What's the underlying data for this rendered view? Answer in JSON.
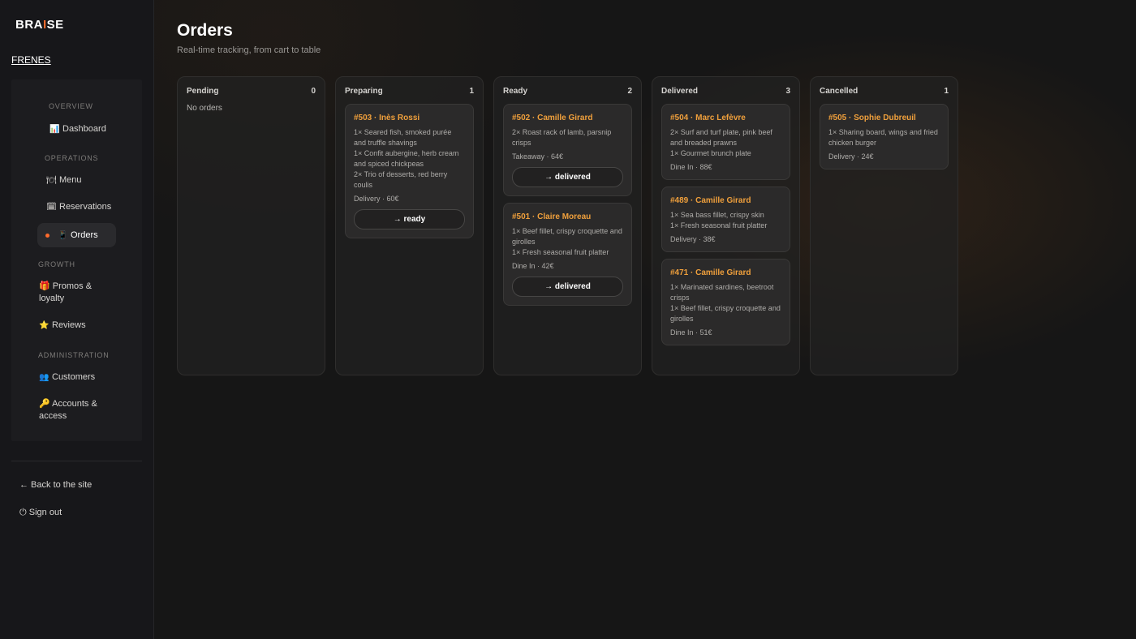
{
  "brand": {
    "prefix": "BRA",
    "accent": "I",
    "suffix": "SE",
    "accent_color": "#ff6b2c"
  },
  "tenant": "FRENES",
  "nav": {
    "sections": {
      "overview": "OVERVIEW",
      "operations": "OPERATIONS",
      "growth": "GROWTH",
      "administration": "ADMINISTRATION"
    },
    "items": {
      "dashboard": {
        "icon": "📊",
        "label": "Dashboard"
      },
      "menu": {
        "icon": "🍽",
        "label": "Menu"
      },
      "reservations": {
        "icon": "🗓",
        "label": "Reservations"
      },
      "orders": {
        "icon": "📱",
        "label": "Orders"
      },
      "promos": {
        "icon": "🎁",
        "label": "Promos & loyalty"
      },
      "reviews": {
        "icon": "⭐",
        "label": "Reviews"
      },
      "customers": {
        "icon": "👥",
        "label": "Customers"
      },
      "accounts": {
        "icon": "🔑",
        "label": "Accounts & access"
      }
    }
  },
  "footer": {
    "back": "← Back to the site",
    "signout": "⏻ Sign out"
  },
  "page": {
    "title": "Orders",
    "subtitle": "Real-time tracking, from cart to table"
  },
  "columns": {
    "pending": {
      "name": "Pending",
      "count": "0",
      "empty": "No orders"
    },
    "preparing": {
      "name": "Preparing",
      "count": "1",
      "cards": [
        {
          "title": "#503 · Inès Rossi",
          "lines": [
            "1× Seared fish, smoked purée and truffle shavings",
            "1× Confit aubergine, herb cream and spiced chickpeas",
            "2× Trio of desserts, red berry coulis"
          ],
          "meta": "Delivery · 60€",
          "action": "→ ready"
        }
      ]
    },
    "ready": {
      "name": "Ready",
      "count": "2",
      "cards": [
        {
          "title": "#502 · Camille Girard",
          "lines": [
            "2× Roast rack of lamb, parsnip crisps"
          ],
          "meta": "Takeaway · 64€",
          "action": "→ delivered"
        },
        {
          "title": "#501 · Claire Moreau",
          "lines": [
            "1× Beef fillet, crispy croquette and girolles",
            "1× Fresh seasonal fruit platter"
          ],
          "meta": "Dine In · 42€",
          "action": "→ delivered"
        }
      ]
    },
    "delivered": {
      "name": "Delivered",
      "count": "3",
      "cards": [
        {
          "title": "#504 · Marc Lefèvre",
          "lines": [
            "2× Surf and turf plate, pink beef and breaded prawns",
            "1× Gourmet brunch plate"
          ],
          "meta": "Dine In · 88€"
        },
        {
          "title": "#489 · Camille Girard",
          "lines": [
            "1× Sea bass fillet, crispy skin",
            "1× Fresh seasonal fruit platter"
          ],
          "meta": "Delivery · 38€"
        },
        {
          "title": "#471 · Camille Girard",
          "lines": [
            "1× Marinated sardines, beetroot crisps",
            "1× Beef fillet, crispy croquette and girolles"
          ],
          "meta": "Dine In · 51€"
        }
      ]
    },
    "cancelled": {
      "name": "Cancelled",
      "count": "1",
      "cards": [
        {
          "title": "#505 · Sophie Dubreuil",
          "lines": [
            "1× Sharing board, wings and fried chicken burger"
          ],
          "meta": "Delivery · 24€"
        }
      ]
    }
  }
}
